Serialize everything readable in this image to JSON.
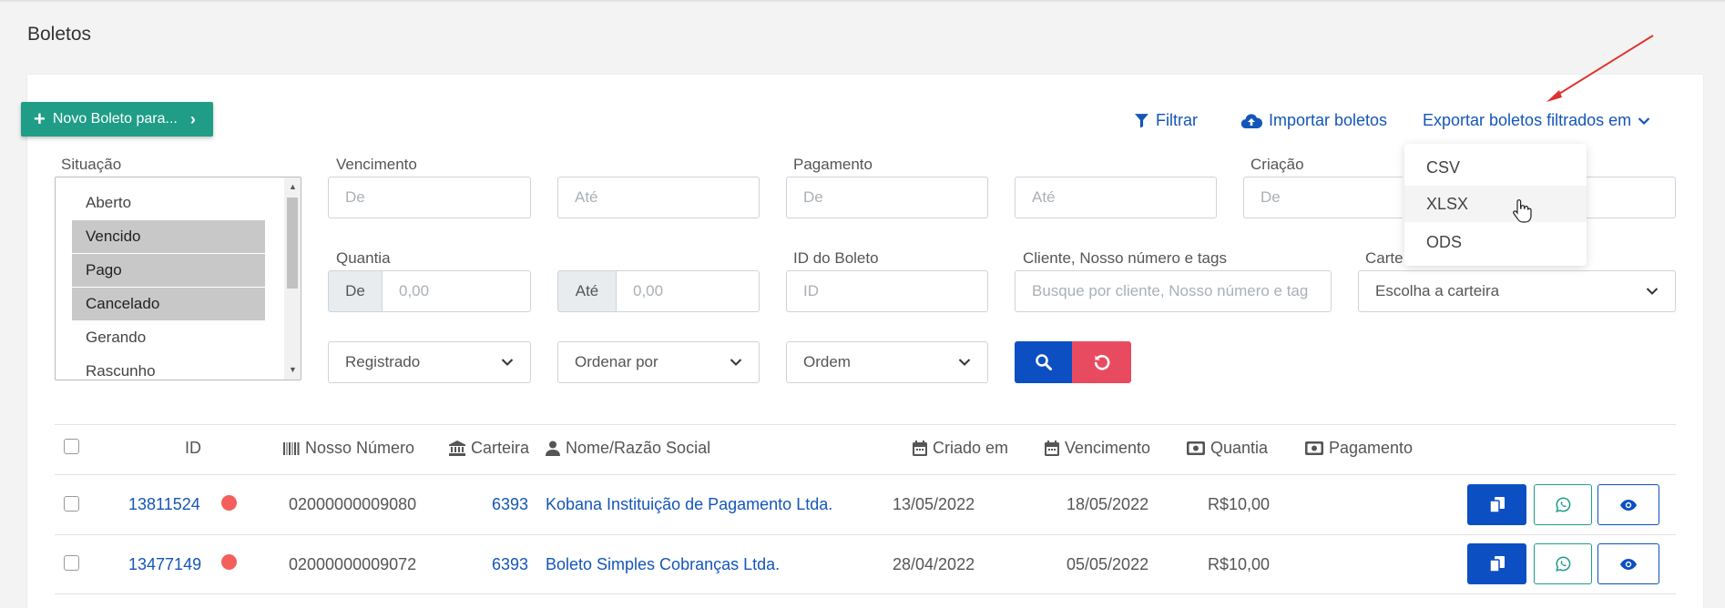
{
  "page": {
    "title": "Boletos"
  },
  "toolbar": {
    "new_button_label": "Novo Boleto para...",
    "filter_label": "Filtrar",
    "import_label": "Importar boletos",
    "export_label": "Exportar boletos filtrados em"
  },
  "export_menu": {
    "items": [
      "CSV",
      "XLSX",
      "ODS"
    ]
  },
  "filters": {
    "situacao_label": "Situação",
    "situacao_options": [
      {
        "label": "Aberto",
        "selected": false
      },
      {
        "label": "Vencido",
        "selected": true
      },
      {
        "label": "Pago",
        "selected": true
      },
      {
        "label": "Cancelado",
        "selected": true
      },
      {
        "label": "Gerando",
        "selected": false
      },
      {
        "label": "Rascunho",
        "selected": false
      }
    ],
    "vencimento_label": "Vencimento",
    "pagamento_label": "Pagamento",
    "criacao_label": "Criação",
    "from_placeholder": "De",
    "to_placeholder": "Até",
    "quantia_label": "Quantia",
    "quantia_from_addon": "De",
    "quantia_to_addon": "Até",
    "amount_placeholder": "0,00",
    "id_label": "ID do Boleto",
    "id_placeholder": "ID",
    "cliente_label": "Cliente, Nosso número e tags",
    "cliente_placeholder": "Busque por cliente, Nosso número e tag",
    "carteira_label": "Carte",
    "carteira_select": "Escolha a carteira",
    "registrado_select": "Registrado",
    "ordenar_select": "Ordenar por",
    "ordem_select": "Ordem"
  },
  "table": {
    "headers": {
      "id": "ID",
      "nosso_numero": "Nosso Número",
      "carteira": "Carteira",
      "nome": "Nome/Razão Social",
      "criado": "Criado em",
      "vencimento": "Vencimento",
      "quantia": "Quantia",
      "pagamento": "Pagamento"
    },
    "rows": [
      {
        "id": "13811524",
        "nosso_numero": "02000000009080",
        "carteira": "6393",
        "nome": "Kobana Instituição de Pagamento Ltda.",
        "criado": "13/05/2022",
        "vencimento": "18/05/2022",
        "quantia": "R$10,00",
        "pagamento": ""
      },
      {
        "id": "13477149",
        "nosso_numero": "02000000009072",
        "carteira": "6393",
        "nome": "Boleto Simples Cobranças Ltda.",
        "criado": "28/04/2022",
        "vencimento": "05/05/2022",
        "quantia": "R$10,00",
        "pagamento": ""
      }
    ]
  },
  "colors": {
    "primary": "#0b4fc2",
    "success": "#1f9d87",
    "danger": "#e84b5f",
    "status_dot": "#f25f5c",
    "link": "#1456b8"
  }
}
